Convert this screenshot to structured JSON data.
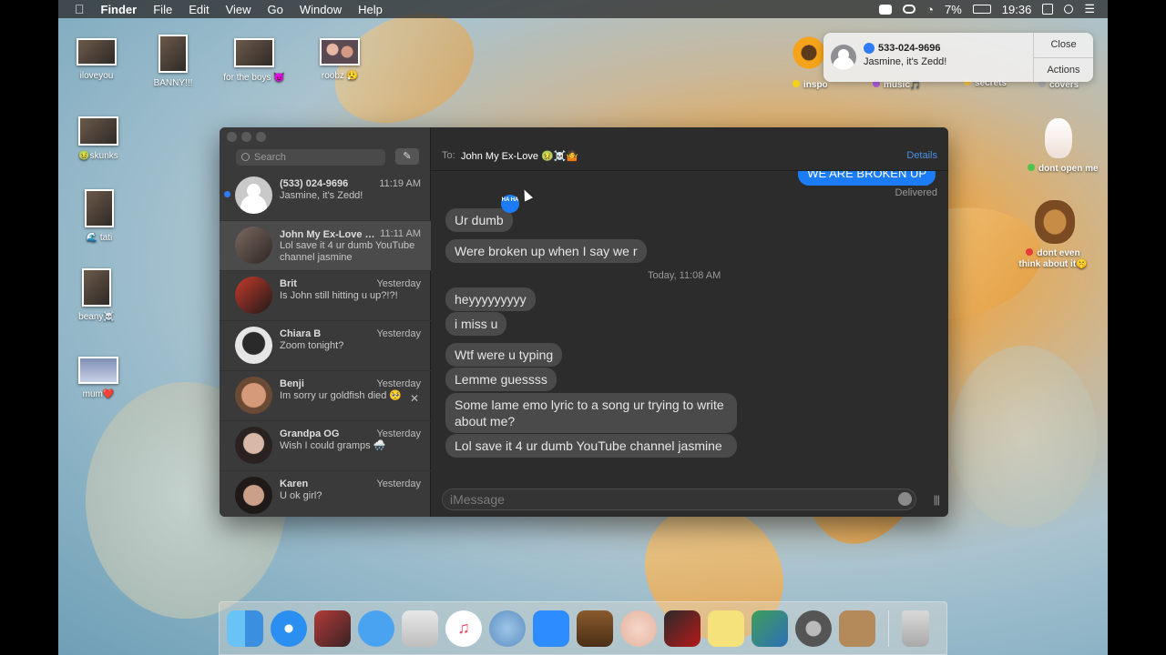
{
  "menubar": {
    "app_name": "Finder",
    "menus": [
      "File",
      "Edit",
      "View",
      "Go",
      "Window",
      "Help"
    ],
    "battery": "7%",
    "time": "19:36",
    "icons": [
      "apple-icon",
      "zoom-icon",
      "creative-cloud-icon",
      "wifi-icon",
      "battery-icon",
      "calendar-icon",
      "search-icon",
      "menu-list-icon"
    ]
  },
  "desktop": {
    "icons": [
      {
        "label": "iloveyou"
      },
      {
        "label": "BANNY!!!"
      },
      {
        "label": "for the boys 😈"
      },
      {
        "label": "roobz 😮‍💨"
      },
      {
        "label": "🤢skunks"
      },
      {
        "label": "🌊 tati"
      },
      {
        "label": "beany☠️"
      },
      {
        "label": "mum❤️"
      }
    ],
    "folders": [
      {
        "label": "inspo"
      },
      {
        "label": "music🎵"
      },
      {
        "label": "secrets"
      },
      {
        "label": "covers"
      },
      {
        "label": "dont open me"
      },
      {
        "label": "dont even think about it🤫"
      }
    ]
  },
  "notification": {
    "title": "533-024-9696",
    "body": "Jasmine, it's Zedd!",
    "close_label": "Close",
    "actions_label": "Actions"
  },
  "messages": {
    "search_placeholder": "Search",
    "compose_icon": "compose-icon",
    "conversations": [
      {
        "name": "(533) 024-9696",
        "time": "11:19 AM",
        "preview": "Jasmine, it's Zedd!",
        "unread": true
      },
      {
        "name": "John My Ex-Love 🤢☠️🤷",
        "time": "11:11 AM",
        "preview": "Lol save it 4 ur dumb YouTube channel jasmine"
      },
      {
        "name": "Brit",
        "time": "Yesterday",
        "preview": "Is John still hitting u up?!?!"
      },
      {
        "name": "Chiara B",
        "time": "Yesterday",
        "preview": "Zoom tonight?"
      },
      {
        "name": "Benji",
        "time": "Yesterday",
        "preview": "Im sorry ur goldfish died 🥺"
      },
      {
        "name": "Grandpa OG",
        "time": "Yesterday",
        "preview": "Wish I could gramps 🌨️"
      },
      {
        "name": "Karen",
        "time": "Yesterday",
        "preview": "U ok girl?"
      }
    ],
    "header": {
      "to_label": "To:",
      "recipient": "John My Ex-Love 🤢☠️🤷",
      "details_label": "Details"
    },
    "thread": {
      "sent_message": "WE ARE BROKEN UP",
      "delivered": "Delivered",
      "tapback": "HA HA",
      "received_1": "Ur dumb",
      "received_2": "Were broken up when I say we r",
      "timestamp": "Today, 11:08 AM",
      "received_3": "heyyyyyyyyy",
      "received_4": "i miss u",
      "received_5": "Wtf were u typing",
      "received_6": "Lemme guessss",
      "received_7": "Some lame emo lyric to a song ur trying to write about me?",
      "received_8": "Lol save it 4 ur dumb YouTube channel jasmine"
    },
    "composer_placeholder": "iMessage"
  },
  "dock": {
    "apps": [
      "finder-icon",
      "safari-icon",
      "photo-booth-icon",
      "messages-icon",
      "cheetah-icon",
      "music-icon",
      "seal-icon",
      "zoom-icon",
      "garageband-icon",
      "face-icon",
      "photo-icon",
      "stickies-icon",
      "preview-icon",
      "system-preferences-icon",
      "contacts-icon",
      "trash-icon"
    ]
  }
}
